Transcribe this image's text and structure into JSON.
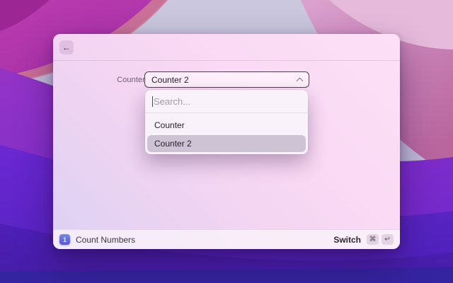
{
  "theme": {
    "selection_highlight": "#cdc3d4",
    "window_tint_top_right": "#fde0f7",
    "window_tint_bottom_left": "#dcd0f2",
    "app_icon_gradient_top": "#7486ea",
    "app_icon_gradient_bottom": "#5a57d6",
    "wallpaper_magenta": "#b238b4",
    "wallpaper_pink": "#d294c6",
    "wallpaper_deep_purple": "#5d24c2"
  },
  "window": {
    "header": {
      "back_icon": "arrow-left",
      "back_glyph": "←"
    },
    "form": {
      "field_label": "Counter",
      "select": {
        "value": "Counter 2",
        "chevron_icon": "chevron-up"
      }
    },
    "dropdown": {
      "search_placeholder": "Search...",
      "options": [
        {
          "label": "Counter",
          "selected": false
        },
        {
          "label": "Counter 2",
          "selected": true
        }
      ]
    },
    "footer": {
      "app_icon_text": "1",
      "command_title": "Count Numbers",
      "action_label": "Switch",
      "keys": [
        "⌘",
        "↵"
      ]
    }
  }
}
